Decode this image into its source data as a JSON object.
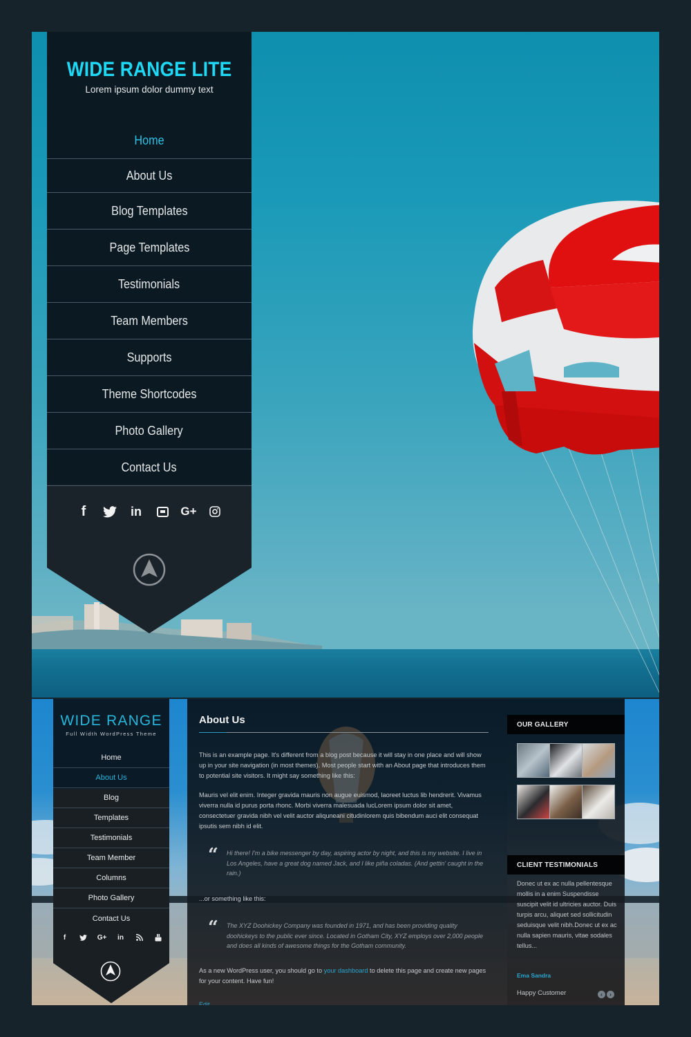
{
  "top_preview": {
    "site_title": "WIDE RANGE LITE",
    "tagline": "Lorem ipsum dolor dummy text",
    "nav": [
      {
        "label": "Home",
        "active": true
      },
      {
        "label": "About Us",
        "active": false
      },
      {
        "label": "Blog Templates",
        "active": false
      },
      {
        "label": "Page Templates",
        "active": false
      },
      {
        "label": "Testimonials",
        "active": false
      },
      {
        "label": "Team Members",
        "active": false
      },
      {
        "label": "Supports",
        "active": false
      },
      {
        "label": "Theme Shortcodes",
        "active": false
      },
      {
        "label": "Photo Gallery",
        "active": false
      },
      {
        "label": "Contact Us",
        "active": false
      }
    ],
    "social_icons": [
      "facebook-icon",
      "twitter-icon",
      "linkedin-icon",
      "youtube-icon",
      "google-plus-icon",
      "instagram-icon"
    ],
    "social_glyphs": {
      "facebook": "f",
      "linkedin": "in",
      "google_plus": "G+"
    },
    "scroll_up_icon": "arrow-up-circle-icon",
    "accent_color": "#1ed8f5",
    "panel_color": "#0b1a22"
  },
  "bottom_preview": {
    "site_title": "WIDE RANGE",
    "tagline": "Full Width WordPress Theme",
    "nav": [
      {
        "label": "Home",
        "active": false
      },
      {
        "label": "About Us",
        "active": true
      },
      {
        "label": "Blog",
        "active": false
      },
      {
        "label": "Templates",
        "active": false
      },
      {
        "label": "Testimonials",
        "active": false
      },
      {
        "label": "Team Member",
        "active": false
      },
      {
        "label": "Columns",
        "active": false
      },
      {
        "label": "Photo Gallery",
        "active": false
      },
      {
        "label": "Contact Us",
        "active": false
      }
    ],
    "social_icons": [
      "facebook-icon",
      "twitter-icon",
      "google-plus-icon",
      "linkedin-icon",
      "rss-icon",
      "youtube-icon"
    ],
    "social_glyphs": {
      "facebook": "f",
      "google_plus": "G+",
      "linkedin": "in"
    },
    "scroll_up_icon": "arrow-up-circle-icon",
    "page": {
      "title": "About Us",
      "intro": "This is an example page. It's different from a blog post because it will stay in one place and will show up in your site navigation (in most themes). Most people start with an About page that introduces them to potential site visitors. It might say something like this:",
      "para2": "Mauris vel elit enim. Integer gravida mauris non augue euismod, laoreet luctus lib hendrerit. Vivamus viverra nulla id purus porta rhonc. Morbi viverra malesuada lucLorem ipsum dolor sit amet, consectetuer gravida nibh vel velit auctor aliquneani citudinlorem quis bibendum auci elit consequat ipsutis sem nibh id elit.",
      "quote1": "Hi there! I'm a bike messenger by day, aspiring actor by night, and this is my website. I live in Los Angeles, have a great dog named Jack, and I like piña coladas. (And gettin' caught in the rain.)",
      "between": "...or something like this:",
      "quote2": "The XYZ Doohickey Company was founded in 1971, and has been providing quality doohickeys to the public ever since. Located in Gotham City, XYZ employs over 2,000 people and does all kinds of awesome things for the Gotham community.",
      "outro_before": "As a new WordPress user, you should go to ",
      "outro_link": "your dashboard",
      "outro_after": " to delete this page and create new pages for your content. Have fun!",
      "edit_label": "Edit"
    },
    "sidebar": {
      "gallery_title": "OUR GALLERY",
      "gallery_thumbs": 6,
      "testimonials_title": "CLIENT TESTIMONIALS",
      "testimonial_text": "Donec ut ex ac nulla pellentesque mollis in a enim Suspendisse suscipit velit id ultricies auctor. Duis turpis arcu, aliquet sed sollicitudin seduisque velit nibh.Donec ut ex ac nulla sapien mauris, vitae sodales tellus...",
      "testimonial_name": "Ema Sandra",
      "testimonial_role": "Happy Customer",
      "prev_icon": "arrow-left-circle-icon",
      "next_icon": "arrow-right-circle-icon",
      "prev_glyph": "‹",
      "next_glyph": "›"
    },
    "accent_color": "#2bb4dc"
  },
  "page_background": "#17232b"
}
